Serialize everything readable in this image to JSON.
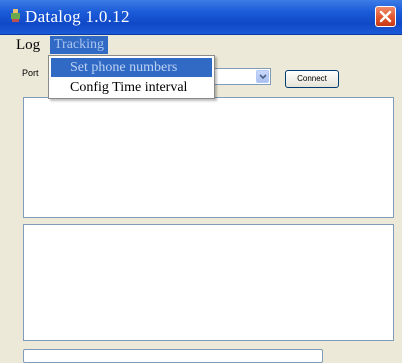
{
  "window": {
    "title": "Datalog 1.0.12"
  },
  "icons": {
    "app": "app-icon",
    "close": "close-icon",
    "dropdown": "chevron-down-icon"
  },
  "menubar": {
    "items": [
      {
        "label": "Log"
      },
      {
        "label": "Tracking"
      }
    ]
  },
  "tracking_menu": {
    "items": [
      {
        "label": "Set phone numbers"
      },
      {
        "label": "Config Time interval"
      }
    ]
  },
  "toolbar": {
    "port_label": "Port",
    "port_value": "",
    "connect_label": "Connect"
  },
  "colors": {
    "titlebar": "#1b5bd8",
    "selection": "#316ac5",
    "close_button": "#e0522a"
  }
}
